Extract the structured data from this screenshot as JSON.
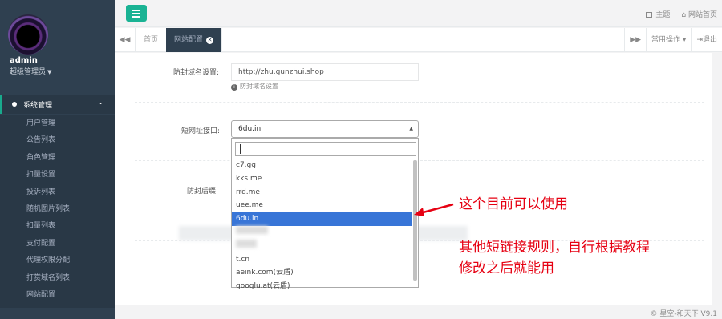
{
  "sidebar": {
    "user_name": "admin",
    "user_role": "超级管理员",
    "menu_head": "系统管理",
    "items": [
      {
        "label": "用户管理"
      },
      {
        "label": "公告列表"
      },
      {
        "label": "角色管理"
      },
      {
        "label": "扣量设置"
      },
      {
        "label": "投诉列表"
      },
      {
        "label": "随机图片列表"
      },
      {
        "label": "扣量列表"
      },
      {
        "label": "支付配置"
      },
      {
        "label": "代理权限分配"
      },
      {
        "label": "打赏域名列表"
      },
      {
        "label": "网站配置"
      }
    ]
  },
  "topbar": {
    "theme_label": "主题",
    "home_label": "网站首页"
  },
  "tabs": {
    "items": [
      {
        "label": "首页"
      },
      {
        "label": "网站配置"
      }
    ],
    "common_ops": "常用操作",
    "logout": "退出"
  },
  "form": {
    "block_domain_label": "防封域名设置:",
    "block_domain_value": "http://zhu.gunzhui.shop",
    "block_domain_help": "防封域名设置",
    "short_url_label": "短网址接口:",
    "short_url_selected": "6du.in",
    "anti_block_label": "防封后缀:",
    "options": [
      "c7.gg",
      "kks.me",
      "rrd.me",
      "uee.me",
      "6du.in",
      "",
      "",
      "t.cn",
      "aeink.com(云盾)",
      "googlu.at(云盾)"
    ]
  },
  "annotations": {
    "note1": "这个目前可以使用",
    "note2_line1": "其他短链接规则，自行根据教程",
    "note2_line2": "修改之后就能用"
  },
  "footer": {
    "copyright": "© 星空-和天下 V9.1"
  },
  "colors": {
    "sidebar_bg": "#2f4050",
    "accent_green": "#1ab394",
    "selected_blue": "#3875d7",
    "annotation_red": "#e60012"
  }
}
